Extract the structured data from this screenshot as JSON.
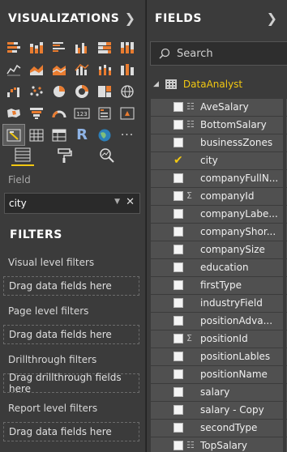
{
  "visualizations": {
    "title": "VISUALIZATIONS",
    "field_label": "Field",
    "field_value": "city",
    "icons": [
      "stacked-bar-chart-icon",
      "stacked-column-chart-icon",
      "clustered-bar-chart-icon",
      "clustered-column-chart-icon",
      "100-stacked-bar-icon",
      "100-stacked-column-icon",
      "line-chart-icon",
      "area-chart-icon",
      "stacked-area-icon",
      "line-column-icon",
      "line-stacked-column-icon",
      "ribbon-chart-icon",
      "waterfall-chart-icon",
      "scatter-chart-icon",
      "pie-chart-icon",
      "donut-chart-icon",
      "treemap-icon",
      "map-icon",
      "filled-map-icon",
      "funnel-icon",
      "gauge-icon",
      "card-icon",
      "multi-row-card-icon",
      "kpi-icon",
      "slicer-icon",
      "table-icon",
      "matrix-icon",
      "r-visual-icon",
      "arcgis-map-icon",
      "more-visuals-icon"
    ],
    "card_text": "123",
    "r_text": "R",
    "more_text": "···"
  },
  "filters": {
    "title": "FILTERS",
    "visual_level": "Visual level filters",
    "page_level": "Page level filters",
    "drillthrough": "Drillthrough filters",
    "report_level": "Report level filters",
    "drag_here": "Drag data fields here",
    "drag_drill": "Drag drillthrough fields here"
  },
  "fields": {
    "title": "FIELDS",
    "search_placeholder": "Search",
    "table_name": "DataAnalyst",
    "items": [
      {
        "name": "AveSalary",
        "icon": "calc",
        "checked": false
      },
      {
        "name": "BottomSalary",
        "icon": "calc",
        "checked": false
      },
      {
        "name": "businessZones",
        "icon": "",
        "checked": false
      },
      {
        "name": "city",
        "icon": "",
        "checked": true
      },
      {
        "name": "companyFullN...",
        "icon": "",
        "checked": false
      },
      {
        "name": "companyId",
        "icon": "sigma",
        "checked": false
      },
      {
        "name": "companyLabe...",
        "icon": "",
        "checked": false
      },
      {
        "name": "companyShor...",
        "icon": "",
        "checked": false
      },
      {
        "name": "companySize",
        "icon": "",
        "checked": false
      },
      {
        "name": "education",
        "icon": "",
        "checked": false
      },
      {
        "name": "firstType",
        "icon": "",
        "checked": false
      },
      {
        "name": "industryField",
        "icon": "",
        "checked": false
      },
      {
        "name": "positionAdva...",
        "icon": "",
        "checked": false
      },
      {
        "name": "positionId",
        "icon": "sigma",
        "checked": false
      },
      {
        "name": "positionLables",
        "icon": "",
        "checked": false
      },
      {
        "name": "positionName",
        "icon": "",
        "checked": false
      },
      {
        "name": "salary",
        "icon": "",
        "checked": false
      },
      {
        "name": "salary - Copy",
        "icon": "",
        "checked": false
      },
      {
        "name": "secondType",
        "icon": "",
        "checked": false
      },
      {
        "name": "TopSalary",
        "icon": "calc",
        "checked": false
      }
    ]
  },
  "colors": {
    "accent": "#f2c811",
    "pane_bg": "#3b3b3b",
    "row_bg": "#505050"
  }
}
